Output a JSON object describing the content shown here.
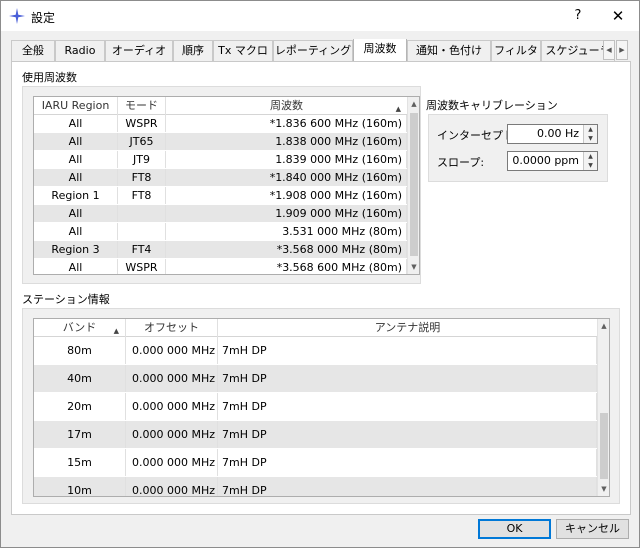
{
  "window": {
    "title": "設定",
    "help": "?",
    "close": "✕"
  },
  "tabs": [
    {
      "label": "全般"
    },
    {
      "label": "Radio"
    },
    {
      "label": "オーディオ"
    },
    {
      "label": "順序"
    },
    {
      "label": "Tx マクロ"
    },
    {
      "label": "レポーティング"
    },
    {
      "label": "周波数",
      "active": true
    },
    {
      "label": "通知・色付け"
    },
    {
      "label": "フィルタ"
    },
    {
      "label": "スケジューラ"
    }
  ],
  "freq": {
    "group_title": "使用周波数",
    "headers": [
      "IARU Region",
      "モード",
      "周波数"
    ],
    "rows": [
      [
        "All",
        "WSPR",
        "*1.836 600 MHz (160m)"
      ],
      [
        "All",
        "JT65",
        "1.838 000 MHz (160m)"
      ],
      [
        "All",
        "JT9",
        "1.839 000 MHz (160m)"
      ],
      [
        "All",
        "FT8",
        "*1.840 000 MHz (160m)"
      ],
      [
        "Region 1",
        "FT8",
        "*1.908 000 MHz (160m)"
      ],
      [
        "All",
        "",
        "1.909 000 MHz (160m)"
      ],
      [
        "All",
        "",
        "3.531 000 MHz (80m)"
      ],
      [
        "Region 3",
        "FT4",
        "*3.568 000 MHz (80m)"
      ],
      [
        "All",
        "WSPR",
        "*3.568 600 MHz (80m)"
      ]
    ]
  },
  "calibration": {
    "title": "周波数キャリブレーション",
    "intercept_label": "インターセプト:",
    "intercept_value": "0.00 Hz",
    "slope_label": "スロープ:",
    "slope_value": "0.0000 ppm"
  },
  "station": {
    "group_title": "ステーション情報",
    "headers": [
      "バンド",
      "オフセット",
      "アンテナ説明"
    ],
    "rows": [
      [
        "80m",
        "0.000 000 MHz",
        "7mH DP"
      ],
      [
        "40m",
        "0.000 000 MHz",
        "7mH DP"
      ],
      [
        "20m",
        "0.000 000 MHz",
        "7mH DP"
      ],
      [
        "17m",
        "0.000 000 MHz",
        "7mH DP"
      ],
      [
        "15m",
        "0.000 000 MHz",
        "7mH DP"
      ],
      [
        "10m",
        "0.000 000 MHz",
        "7mH DP"
      ]
    ]
  },
  "buttons": {
    "ok": "OK",
    "cancel": "キャンセル"
  },
  "icons": {
    "app": "sparkle-icon",
    "sort": "sort-up-icon",
    "tab_left": "chevron-left-icon",
    "tab_right": "chevron-right-icon"
  },
  "colors": {
    "accent": "#0078d7",
    "alt_row": "#e6e6e6",
    "app_icon": "#4a5fd8"
  }
}
